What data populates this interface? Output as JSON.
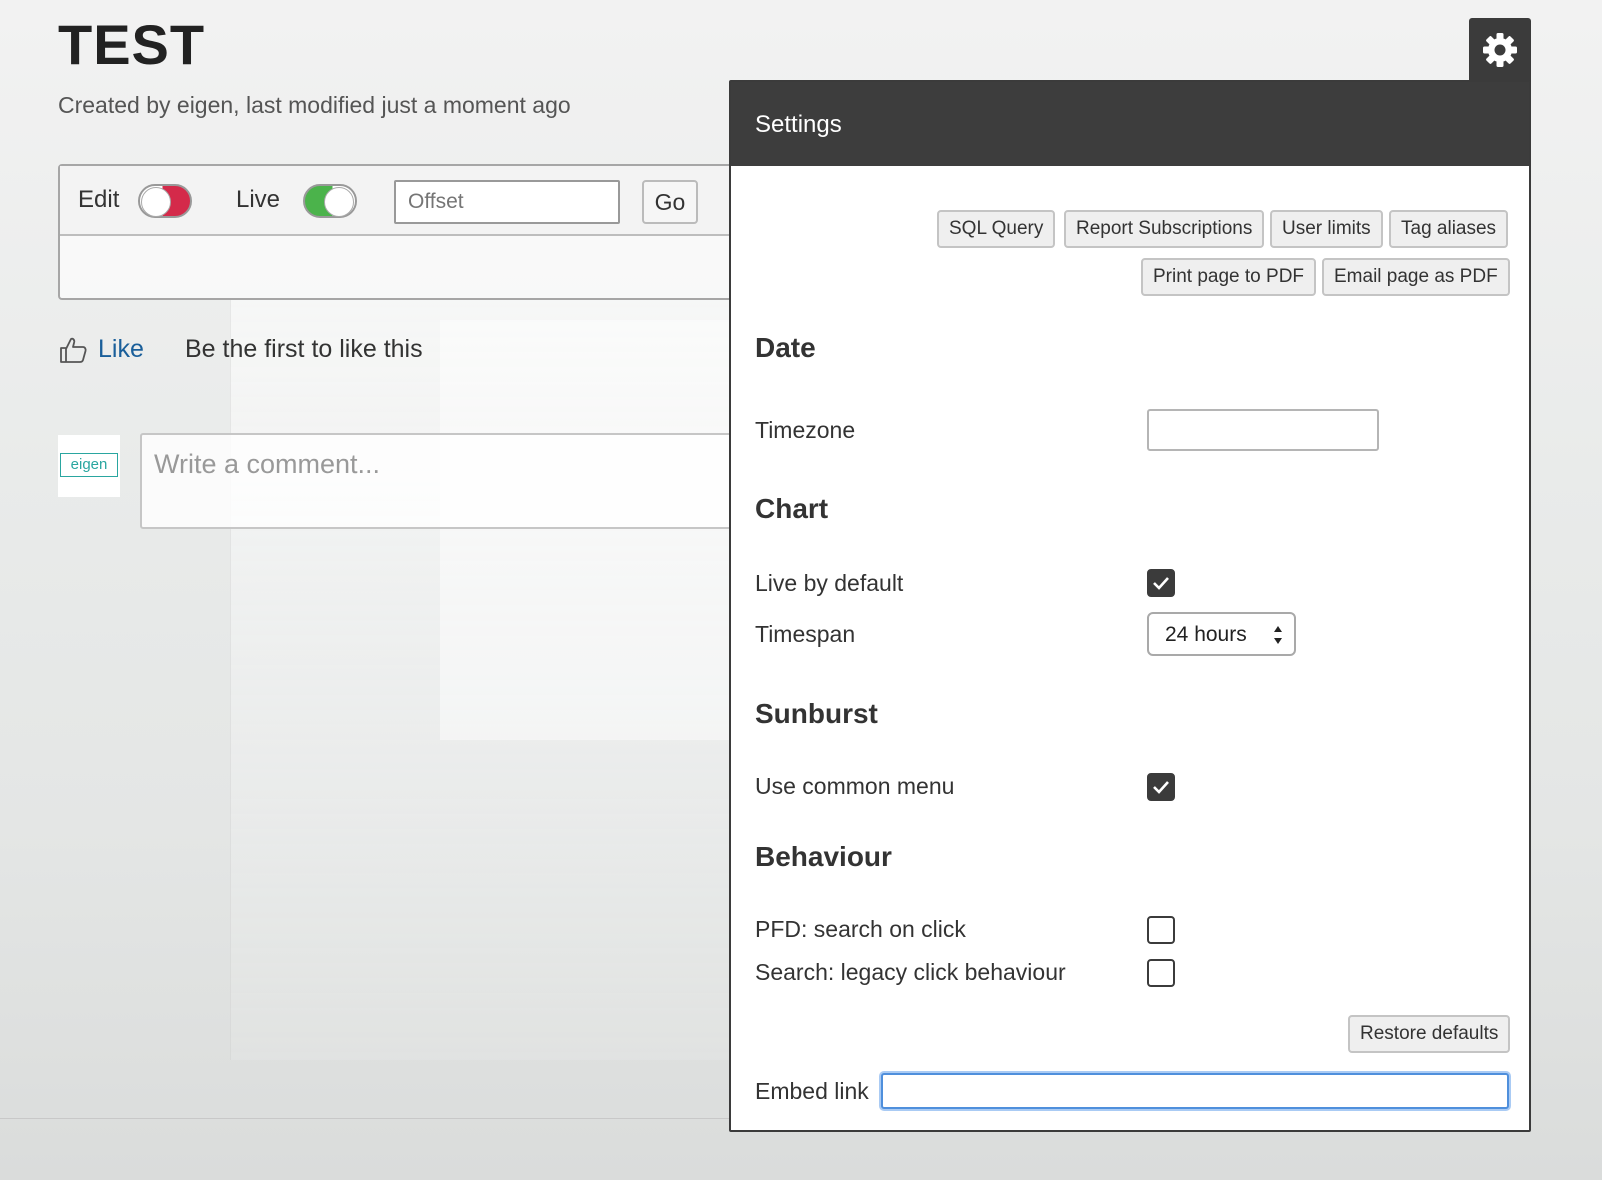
{
  "page": {
    "title": "TEST",
    "meta": "Created by eigen, last modified just a moment ago"
  },
  "controls": {
    "edit_label": "Edit",
    "live_label": "Live",
    "edit_on": false,
    "live_on": true,
    "offset_placeholder": "Offset",
    "go_label": "Go"
  },
  "like": {
    "link_label": "Like",
    "text": "Be the first to like this"
  },
  "comment": {
    "avatar_text": "eigen",
    "placeholder": "Write a comment..."
  },
  "settings": {
    "title": "Settings",
    "buttons_row1": [
      "SQL Query",
      "Report Subscriptions",
      "User limits",
      "Tag aliases"
    ],
    "buttons_row2": [
      "Print page to PDF",
      "Email page as PDF"
    ],
    "sections": {
      "date": "Date",
      "chart": "Chart",
      "sunburst": "Sunburst",
      "behaviour": "Behaviour"
    },
    "timezone_label": "Timezone",
    "timezone_value": "",
    "live_by_default_label": "Live by default",
    "live_by_default": true,
    "timespan_label": "Timespan",
    "timespan_value": "24 hours",
    "use_common_menu_label": "Use common menu",
    "use_common_menu": true,
    "pfd_search_label": "PFD: search on click",
    "pfd_search": false,
    "legacy_click_label": "Search: legacy click behaviour",
    "legacy_click": false,
    "restore_defaults_label": "Restore defaults",
    "embed_link_label": "Embed link",
    "embed_link_value": ""
  },
  "icons": {
    "settings": "gear-icon",
    "like": "thumbs-up-icon",
    "select": "up-down-arrows-icon",
    "check": "checkmark-icon"
  },
  "colors": {
    "panel_header": "#3d3d3d",
    "toggle_off": "#d42a4a",
    "toggle_on": "#4bb34b",
    "link": "#1a5f9a",
    "focus": "#4f8fdc"
  }
}
